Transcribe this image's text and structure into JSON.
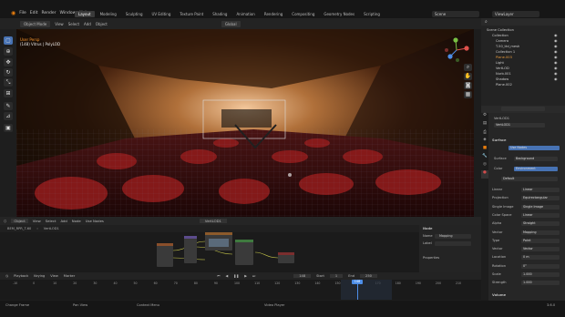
{
  "app": {
    "menus": [
      "File",
      "Edit",
      "Render",
      "Window",
      "Help"
    ],
    "workspace_tabs": [
      "Layout",
      "Modeling",
      "Sculpting",
      "UV Editing",
      "Texture Paint",
      "Shading",
      "Animation",
      "Rendering",
      "Compositing",
      "Geometry Nodes",
      "Scripting"
    ],
    "active_tab": "Layout",
    "scene": "Scene",
    "view_layer": "ViewLayer"
  },
  "viewport": {
    "mode": "Object Mode",
    "header_menus": [
      "View",
      "Select",
      "Add",
      "Object"
    ],
    "transform": "Global",
    "info_line1": "User Persp",
    "info_line2": "(148) Vitrus | PolyLOD",
    "tools": [
      "select-box",
      "cursor",
      "move",
      "rotate",
      "scale",
      "transform",
      "annotate",
      "measure",
      "add-cube"
    ]
  },
  "node_editor": {
    "mode": "Object",
    "menus": [
      "View",
      "Select",
      "Add",
      "Node"
    ],
    "use_nodes": "Use Nodes",
    "material": "VertLOD1",
    "breadcrumb_obj": "BEM_RPR_T-60",
    "breadcrumb_mat": "VertLOD1",
    "panel_title": "Node",
    "panel_rows": [
      {
        "label": "Name",
        "value": "Mapping"
      },
      {
        "label": "Label",
        "value": ""
      }
    ],
    "panel_sub": "Properties"
  },
  "timeline": {
    "mode": "Playback",
    "menus": [
      "Keying",
      "View",
      "Marker"
    ],
    "current_frame": "148",
    "start_label": "Start",
    "start": "1",
    "end_label": "End",
    "end": "250",
    "ticks": [
      "-10",
      "0",
      "10",
      "20",
      "30",
      "40",
      "50",
      "60",
      "70",
      "80",
      "90",
      "100",
      "110",
      "120",
      "130",
      "140",
      "150",
      "160",
      "170",
      "180",
      "190",
      "200",
      "210"
    ]
  },
  "outliner": {
    "title": "Scene Collection",
    "items": [
      "Collection",
      "Camera",
      "T-50_ttd_mesh",
      "Collection 1",
      "Plane.003",
      "Light",
      "VertLOD",
      "Nurb.001",
      "Shadow",
      "Plane.002"
    ]
  },
  "properties": {
    "object_name": "VertLOD1",
    "material_name": "VertLOD1",
    "surface_label": "Surface",
    "use_nodes": "Use Nodes",
    "surface_field": "Background",
    "color_field": "Environment",
    "vector_field": "Default",
    "rows": [
      {
        "label": "Linear",
        "value": "Linear"
      },
      {
        "label": "Projection",
        "value": "Equirectangular"
      },
      {
        "label": "Single Image",
        "value": "Single Image"
      },
      {
        "label": "Color Space",
        "value": "Linear"
      },
      {
        "label": "Alpha",
        "value": "Straight"
      },
      {
        "label": "Vector",
        "value": "Mapping"
      },
      {
        "label": "Type",
        "value": "Point"
      },
      {
        "label": "Vector",
        "value": "Vector"
      },
      {
        "label": "Location",
        "value": "0 m"
      },
      {
        "label": "Rotation",
        "value": "0°"
      },
      {
        "label": "Scale",
        "value": "1.000"
      },
      {
        "label": "Strength",
        "value": "1.000"
      }
    ],
    "volume_label": "Volume",
    "settings_label": "Settings"
  },
  "statusbar": {
    "left": "Change Frame",
    "mid1": "Pan View",
    "mid2": "Context Menu",
    "right": "Video Player",
    "version": "3.6.0"
  }
}
